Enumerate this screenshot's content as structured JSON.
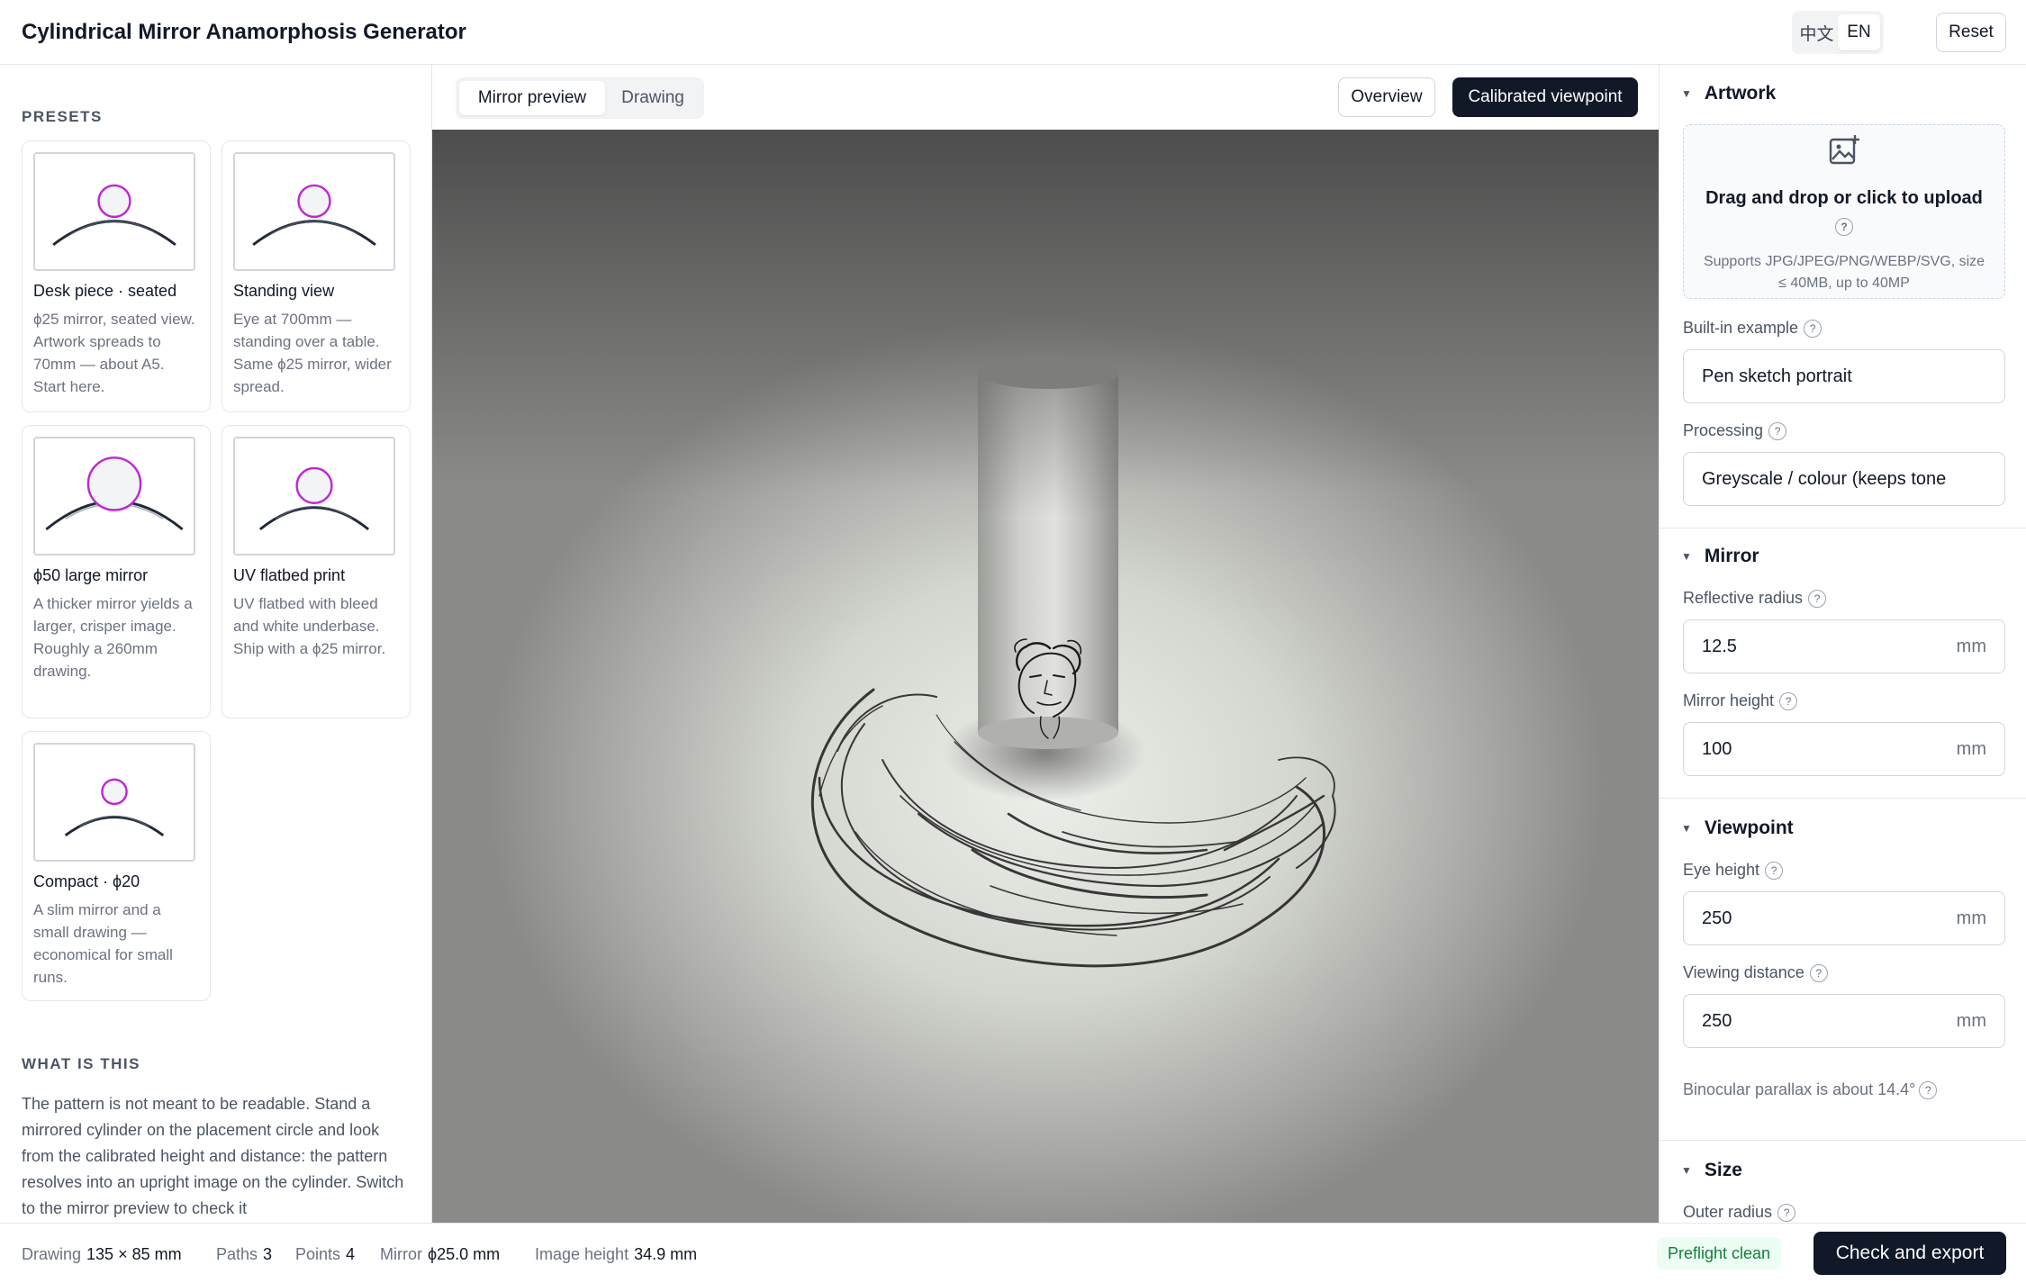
{
  "header": {
    "title": "Cylindrical Mirror Anamorphosis Generator",
    "lang_zh": "中文",
    "lang_en": "EN",
    "reset": "Reset"
  },
  "left": {
    "presets_label": "PRESETS",
    "presets": [
      {
        "name": "Desk piece · seated",
        "desc": "ϕ25 mirror, seated view. Artwork spreads to 70mm — about A5. Start here."
      },
      {
        "name": "Standing view",
        "desc": "Eye at 700mm — standing over a table. Same ϕ25 mirror, wider spread."
      },
      {
        "name": "ϕ50 large mirror",
        "desc": "A thicker mirror yields a larger, crisper image. Roughly a 260mm drawing."
      },
      {
        "name": "UV flatbed print",
        "desc": "UV flatbed with bleed and white underbase. Ship with a ϕ25 mirror."
      },
      {
        "name": "Compact · ϕ20",
        "desc": "A slim mirror and a small drawing — economical for small runs."
      }
    ],
    "about_label": "WHAT IS THIS",
    "about_text": "The pattern is not meant to be readable. Stand a mirrored cylinder on the placement circle and look from the calibrated height and distance: the pattern resolves into an upright image on the cylinder. Switch to the mirror preview to check it"
  },
  "center": {
    "tabs": [
      "Mirror preview",
      "Drawing"
    ],
    "overview": "Overview",
    "calibrated": "Calibrated viewpoint"
  },
  "right": {
    "artwork": {
      "title": "Artwork",
      "upload_title": "Drag and drop or click to upload",
      "upload_sub": "Supports JPG/JPEG/PNG/WEBP/SVG, size ≤ 40MB, up to 40MP",
      "example_label": "Built-in example",
      "example_value": "Pen sketch portrait",
      "processing_label": "Processing",
      "processing_value": "Greyscale / colour (keeps tone"
    },
    "mirror": {
      "title": "Mirror",
      "radius_label": "Reflective radius",
      "radius_value": "12.5",
      "height_label": "Mirror height",
      "height_value": "100",
      "unit": "mm"
    },
    "viewpoint": {
      "title": "Viewpoint",
      "eye_label": "Eye height",
      "eye_value": "250",
      "dist_label": "Viewing distance",
      "dist_value": "250",
      "unit": "mm",
      "parallax": "Binocular parallax is about 14.4°"
    },
    "size": {
      "title": "Size",
      "outer_label": "Outer radius"
    }
  },
  "footer": {
    "drawing_label": "Drawing",
    "drawing_value": "135 × 85 mm",
    "paths_label": "Paths",
    "paths_value": "3",
    "points_label": "Points",
    "points_value": "4",
    "mirror_label": "Mirror",
    "mirror_value": "ϕ25.0 mm",
    "imgh_label": "Image height",
    "imgh_value": "34.9 mm",
    "preflight": "Preflight clean",
    "export": "Check and export"
  },
  "colors": {
    "accent_dark": "#111827",
    "preset_circle": "#c026d3",
    "preflight_green": "#15803d"
  }
}
